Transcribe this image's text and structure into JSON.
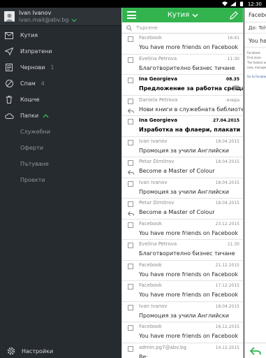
{
  "status_bar": {
    "time": "12:30"
  },
  "account": {
    "name": "Ivan Ivanov",
    "email": "ivan.mail@abv.bg"
  },
  "nav": [
    {
      "label": "Кутия",
      "count": ""
    },
    {
      "label": "Изпратени",
      "count": ""
    },
    {
      "label": "Чернови",
      "count": "1"
    },
    {
      "label": "Спам",
      "count": "4"
    },
    {
      "label": "Кошче",
      "count": ""
    },
    {
      "label": "Папки",
      "count": ""
    }
  ],
  "folders": [
    "Служебни",
    "Оферти",
    "Пътуване",
    "Проекти"
  ],
  "settings_label": "Настройки",
  "list_header": {
    "title": "Кутия"
  },
  "search": {
    "placeholder": "Търсене"
  },
  "messages": [
    {
      "from": "Facebook",
      "date": "16:41",
      "subject": "You have more friends on Facebook"
    },
    {
      "from": "Evelina Petrova",
      "date": "11:30",
      "subject": "Благотворително бизнес тичане"
    },
    {
      "from": "Ina Georgieva",
      "date": "08.35",
      "subject": "Предложение за работна среща"
    },
    {
      "from": "Daniela Petrova",
      "date": "вчера",
      "subject": "Нови книги в служебната библиотека"
    },
    {
      "from": "Ina Georgieva",
      "date": "27.04.2015",
      "subject": "Изработка на флаери, плакати"
    },
    {
      "from": "Ivan Ivanov",
      "date": "18.04.2015",
      "subject": "Промоция за учили Английски"
    },
    {
      "from": "Petar Dimitrov",
      "date": "18.04.2015",
      "subject": "Become a Master of Colour"
    },
    {
      "from": "Ivan Ivanov",
      "date": "18.04.2015",
      "subject": "Промоция за учили Английски"
    },
    {
      "from": "Petar Dimitrov",
      "date": "18.04.2015",
      "subject": "Become a Master of Colour"
    },
    {
      "from": "Facebook",
      "date": "23.12.2015",
      "subject": "You have more friends on Facebook"
    },
    {
      "from": "Evelina Petrova",
      "date": "11.30",
      "subject": "Благотворително бизнес тичане"
    },
    {
      "from": "Facebook",
      "date": "21.12.2015",
      "subject": "You have more friends on Facebook"
    },
    {
      "from": "Facebook",
      "date": "17.12.2015",
      "subject": "You have more friends on Facebook"
    },
    {
      "from": "Ivan Ivanov",
      "date": "18.04.2015",
      "subject": "Промоция за учили Английски"
    },
    {
      "from": "Facebook",
      "date": "16.12.2015",
      "subject": "You have more friends on Facebook"
    },
    {
      "from": "admin.pg7@abv.bg",
      "date": "14.12.2015",
      "subject": "Re:"
    }
  ],
  "reading_pane": {
    "sender": "Facebook",
    "to_label": "До:",
    "to_value": "Tolv",
    "subject": "You ha",
    "body_source": "Facebook",
    "body_line1": "Find more",
    "body_line2": "The fastest way",
    "body_line3": "new, manage",
    "body_link": "Go to Facebook"
  }
}
